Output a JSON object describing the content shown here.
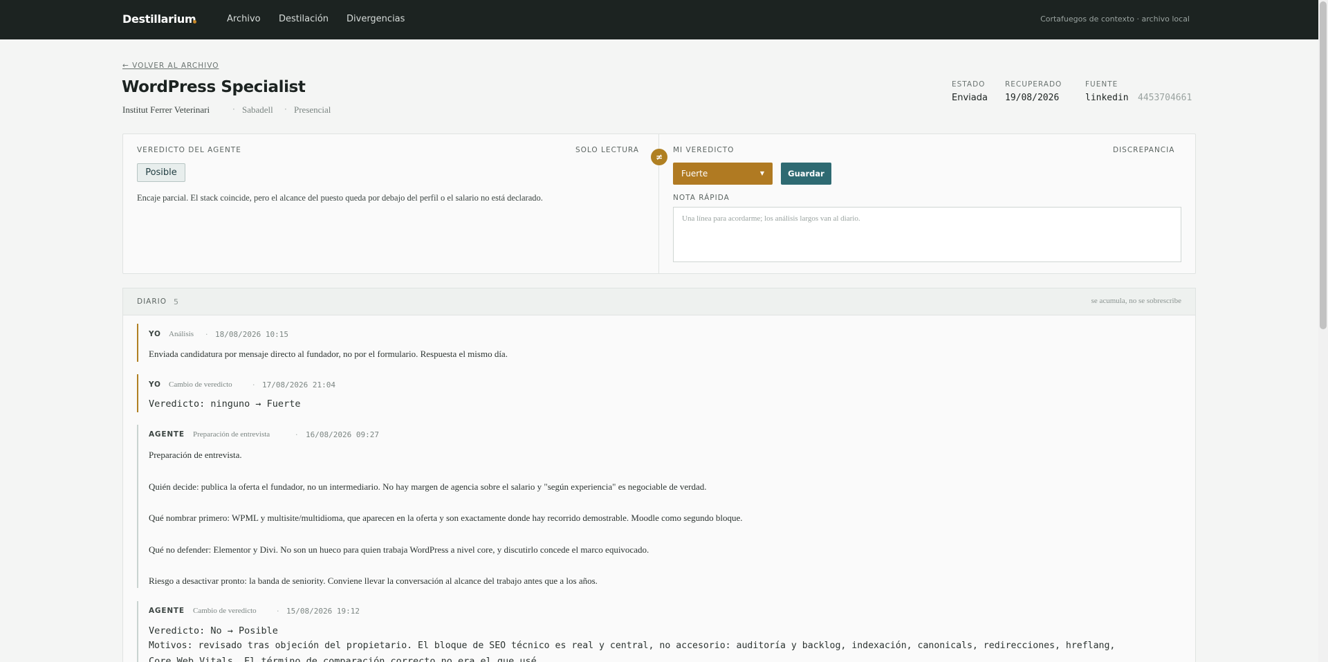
{
  "topbar": {
    "brand": "Destillarium",
    "nav": [
      "Archivo",
      "Destilación",
      "Divergencias"
    ],
    "right_text": "Cortafuegos de contexto · archivo local"
  },
  "header": {
    "back_link": "← VOLVER AL ARCHIVO",
    "title": "WordPress Specialist",
    "title_icon": "external-link-icon",
    "company": "Institut Ferrer Veterinari",
    "location": "Sabadell",
    "modality": "Presencial",
    "separator": "·",
    "facts": {
      "estado_label": "ESTADO",
      "estado_value": "Enviada",
      "recuperado_label": "RECUPERADO",
      "recuperado_value": "19/08/2026",
      "fuente_label": "FUENTE",
      "fuente_value": "linkedin",
      "fuente_id": "4453704661"
    }
  },
  "verdicts": {
    "agent_label": "VEREDICTO DEL AGENTE",
    "agent_readonly": "SOLO LECTURA",
    "agent_badge": "Posible",
    "agent_note": "Encaje parcial. El stack coincide, pero el alcance del puesto queda por debajo del perfil o el salario no está declarado.",
    "neq_symbol": "≠",
    "mine_label": "MI VEREDICTO",
    "mine_flag": "DISCREPANCIA",
    "mine_selected": "Fuerte",
    "save_label": "Guardar",
    "quick_note_label": "NOTA RÁPIDA",
    "quick_note_placeholder": "Una línea para acordarme; los análisis largos van al diario.",
    "quick_note_value": ""
  },
  "diary": {
    "title": "DIARIO",
    "count": "5",
    "right_text": "se acumula, no se sobrescribe",
    "entries": [
      {
        "who": "YO",
        "kind": "Análisis",
        "time": "18/08/2026 10:15",
        "text": "Enviada candidatura por mensaje directo al fundador, no por el formulario. Respuesta el mismo día."
      },
      {
        "who": "YO",
        "kind": "Cambio de veredicto",
        "time": "17/08/2026 21:04",
        "text": "Veredicto: ninguno → Fuerte"
      },
      {
        "who": "AGENTE",
        "kind": "Preparación de entrevista",
        "time": "16/08/2026 09:27",
        "paragraphs": [
          "Preparación de entrevista.",
          "Quién decide: publica la oferta el fundador, no un intermediario. No hay margen de agencia sobre el salario y \"según experiencia\" es negociable de verdad.",
          "Qué nombrar primero: WPML y multisite/multidioma, que aparecen en la oferta y son exactamente donde hay recorrido demostrable. Moodle como segundo bloque.",
          "Qué no defender: Elementor y Divi. No son un hueco para quien trabaja WordPress a nivel core, y discutirlo concede el marco equivocado.",
          "Riesgo a desactivar pronto: la banda de seniority. Conviene llevar la conversación al alcance del trabajo antes que a los años."
        ]
      },
      {
        "who": "AGENTE",
        "kind": "Cambio de veredicto",
        "time": "15/08/2026 19:12",
        "lines": [
          "Veredicto: No → Posible",
          "Motivos: revisado tras objeción del propietario. El bloque de SEO técnico es real y central, no accesorio: auditoría y backlog, indexación, canonicals, redirecciones, hreflang,",
          "Core Web Vitals. El término de comparación correcto no era el que usé."
        ]
      }
    ]
  },
  "colors": {
    "topbar": "#1c2321",
    "accent_gold": "#b08022",
    "accent_teal": "#2e6a72",
    "badge_bg": "#e8eeed"
  }
}
